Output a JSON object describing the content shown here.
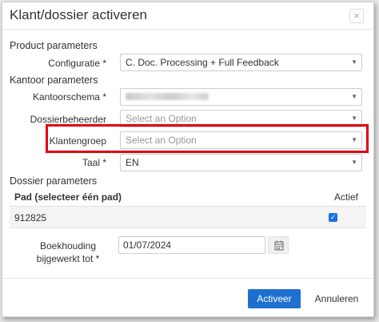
{
  "dialog": {
    "title": "Klant/dossier activeren",
    "close_label": "×"
  },
  "sections": {
    "product": "Product parameters",
    "kantoor": "Kantoor parameters",
    "dossier": "Dossier parameters"
  },
  "fields": {
    "configuratie": {
      "label": "Configuratie *",
      "value": "C. Doc. Processing + Full Feedback"
    },
    "kantoorschema": {
      "label": "Kantoorschema *"
    },
    "dossierbeheerder": {
      "label": "Dossierbeheerder",
      "placeholder": "Select an Option"
    },
    "klantengroep": {
      "label": "Klantengroep",
      "placeholder": "Select an Option"
    },
    "taal": {
      "label": "Taal *",
      "value": "EN"
    }
  },
  "table": {
    "col_pad": "Pad (selecteer één pad)",
    "col_actief": "Actief",
    "rows": [
      {
        "pad": "912825",
        "actief": true
      }
    ]
  },
  "boekhouding": {
    "label": "Boekhouding bijgewerkt tot *",
    "value": "01/07/2024"
  },
  "footer": {
    "activate_label": "Activeer",
    "cancel_label": "Annuleren"
  },
  "colors": {
    "primary": "#1e6fd0",
    "highlight": "#e3000f"
  }
}
